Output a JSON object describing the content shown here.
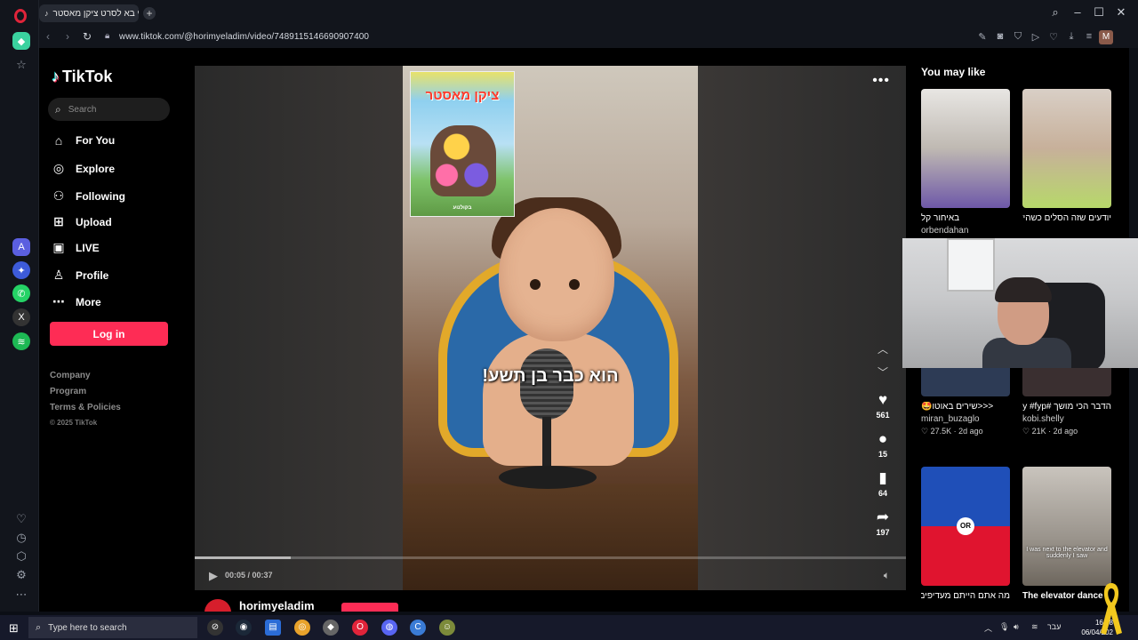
{
  "browser": {
    "tab_title": "מי בא לסרט ציקן מאסטר",
    "url": "www.tiktok.com/@horimyeladim/video/7489115146690907400",
    "profile_initial": "M"
  },
  "tiktok": {
    "logo": "TikTok",
    "search_placeholder": "Search",
    "nav": [
      {
        "label": "For You",
        "icon": "home-icon"
      },
      {
        "label": "Explore",
        "icon": "compass-icon"
      },
      {
        "label": "Following",
        "icon": "following-icon"
      },
      {
        "label": "Upload",
        "icon": "upload-icon"
      },
      {
        "label": "LIVE",
        "icon": "live-icon"
      },
      {
        "label": "Profile",
        "icon": "profile-icon"
      },
      {
        "label": "More",
        "icon": "more-icon"
      }
    ],
    "login_label": "Log in",
    "footer": {
      "company": "Company",
      "program": "Program",
      "terms": "Terms & Policies",
      "copyright": "© 2025 TikTok"
    }
  },
  "video": {
    "poster_title": "ציקן מאסטר",
    "poster_footer": "בקולנוע",
    "caption": "הוא כבר בן תשע!",
    "likes": "561",
    "comments": "15",
    "saves": "64",
    "shares": "197",
    "time": "00:05 / 00:37",
    "progress": 0.135,
    "author": "horimyeladim"
  },
  "you_may_like": {
    "title": "You may like",
    "cards": [
      {
        "title": "באיחור קל",
        "author": "orbendahan",
        "meta": ""
      },
      {
        "title": "יודעים שזה הסלים כשהיד מתחילה להתערס #פוריוו",
        "author": "",
        "meta": ""
      },
      {
        "title": "<<<שירים באוטו🤩",
        "author": "miran_buzaglo",
        "meta": "♡ 27.5K · 2d ago"
      },
      {
        "title": "הדבר הכי מושך #kobishelly #fyp",
        "author": "kobi.shelly",
        "meta": "♡ 21K · 2d ago"
      },
      {
        "title": "מה אתם הייתם מעדיפים",
        "author": "",
        "meta": ""
      },
      {
        "title": "The elevator dance",
        "author": "",
        "meta": ""
      }
    ],
    "or_label": "OR",
    "elevator_caption": "I was next to the elevator and suddenly I saw"
  },
  "taskbar": {
    "search_text": "Type here to search",
    "lang": "עבר",
    "time": "16:18",
    "date": "06/04/202"
  },
  "colors": {
    "accent": "#fe2c55",
    "background": "#000000"
  }
}
